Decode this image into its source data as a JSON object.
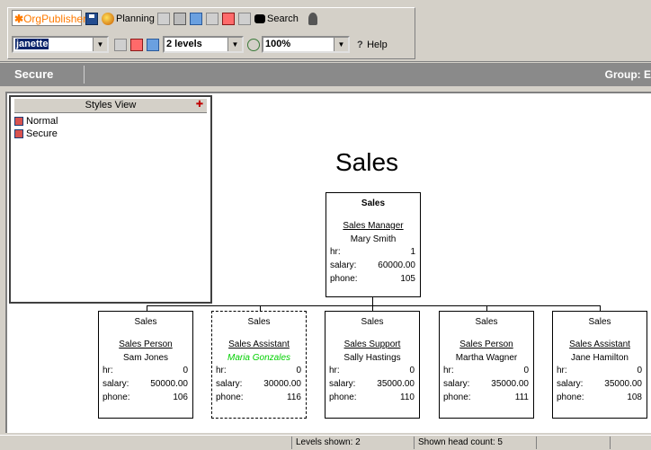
{
  "toolbar": {
    "brand": "OrgPublisher",
    "planning": "Planning",
    "search": "Search",
    "user_combo": "janette",
    "levels_combo": "2 levels",
    "zoom_combo": "100%",
    "help": "Help"
  },
  "header": {
    "view_label": "Secure",
    "group_label": "Group: E"
  },
  "styles_view": {
    "title": "Styles View",
    "items": [
      {
        "label": "Normal"
      },
      {
        "label": "Secure"
      }
    ]
  },
  "chart": {
    "title": "Sales",
    "top": {
      "dept": "Sales",
      "role": "Sales Manager",
      "name": "Mary Smith",
      "hr_label": "hr:",
      "hr": "1",
      "salary_label": "salary:",
      "salary": "60000.00",
      "phone_label": "phone:",
      "phone": "105"
    },
    "children": [
      {
        "dept": "Sales",
        "role": "Sales Person",
        "name": "Sam Jones",
        "hr_label": "hr:",
        "hr": "0",
        "salary_label": "salary:",
        "salary": "50000.00",
        "phone_label": "phone:",
        "phone": "106"
      },
      {
        "dept": "Sales",
        "role": "Sales Assistant",
        "name": "Maria Gonzales",
        "hr_label": "hr:",
        "hr": "0",
        "salary_label": "salary:",
        "salary": "30000.00",
        "phone_label": "phone:",
        "phone": "116"
      },
      {
        "dept": "Sales",
        "role": "Sales Support",
        "name": "Sally Hastings",
        "hr_label": "hr:",
        "hr": "0",
        "salary_label": "salary:",
        "salary": "35000.00",
        "phone_label": "phone:",
        "phone": "110"
      },
      {
        "dept": "Sales",
        "role": "Sales Person",
        "name": "Martha Wagner",
        "hr_label": "hr:",
        "hr": "0",
        "salary_label": "salary:",
        "salary": "35000.00",
        "phone_label": "phone:",
        "phone": "111"
      },
      {
        "dept": "Sales",
        "role": "Sales Assistant",
        "name": "Jane Hamilton",
        "hr_label": "hr:",
        "hr": "0",
        "salary_label": "salary:",
        "salary": "35000.00",
        "phone_label": "phone:",
        "phone": "108"
      }
    ]
  },
  "status": {
    "levels": "Levels shown: 2",
    "headcount": "Shown head count: 5"
  },
  "colors": {
    "vacant_name": "#00d000",
    "brand": "#ff7a00",
    "header_bar": "#8a8a8a"
  }
}
